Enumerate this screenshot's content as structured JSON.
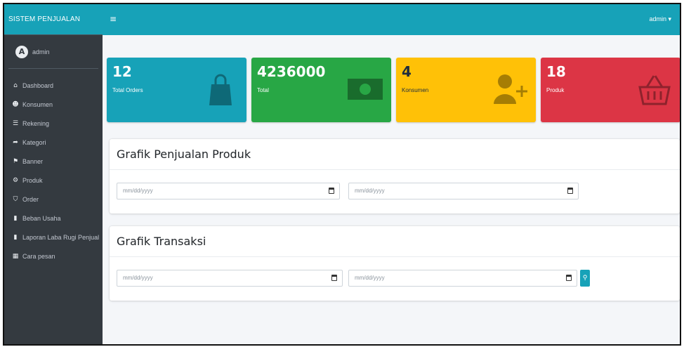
{
  "app": {
    "brand": "SISTEM PENJUALAN"
  },
  "user": {
    "name": "admin",
    "menu_label": "admin ▾"
  },
  "sidebar": {
    "items": [
      {
        "label": "Dashboard",
        "icon": "dashboard-icon",
        "glyph": "⌂"
      },
      {
        "label": "Konsumen",
        "icon": "users-icon",
        "glyph": "☻"
      },
      {
        "label": "Rekening",
        "icon": "list-icon",
        "glyph": "☰"
      },
      {
        "label": "Kategori",
        "icon": "share-icon",
        "glyph": "➦"
      },
      {
        "label": "Banner",
        "icon": "flag-icon",
        "glyph": "⚑"
      },
      {
        "label": "Produk",
        "icon": "tags-icon",
        "glyph": "⚙"
      },
      {
        "label": "Order",
        "icon": "bag-icon",
        "glyph": "⛉"
      },
      {
        "label": "Beban Usaha",
        "icon": "file-icon",
        "glyph": "▮"
      },
      {
        "label": "Laporan Laba Rugi Penjual",
        "icon": "report-icon",
        "glyph": "▮"
      },
      {
        "label": "Cara pesan",
        "icon": "grid-icon",
        "glyph": "▦"
      }
    ]
  },
  "stats": [
    {
      "value": "12",
      "label": "Total Orders",
      "color": "#17a2b8",
      "icon": "shopping-bag-icon"
    },
    {
      "value": "4236000",
      "label": "Total",
      "color": "#28a745",
      "icon": "money-icon"
    },
    {
      "value": "4",
      "label": "Konsumen",
      "color": "#ffc107",
      "icon": "user-plus-icon"
    },
    {
      "value": "18",
      "label": "Produk",
      "color": "#dc3545",
      "icon": "basket-icon"
    }
  ],
  "cards": {
    "penjualan": {
      "title": "Grafik Penjualan Produk",
      "start_placeholder": "mm/dd/yyyy",
      "end_placeholder": "mm/dd/yyyy"
    },
    "transaksi": {
      "title": "Grafik Transaksi",
      "start_placeholder": "mm/dd/yyyy",
      "end_placeholder": "mm/dd/yyyy"
    }
  }
}
